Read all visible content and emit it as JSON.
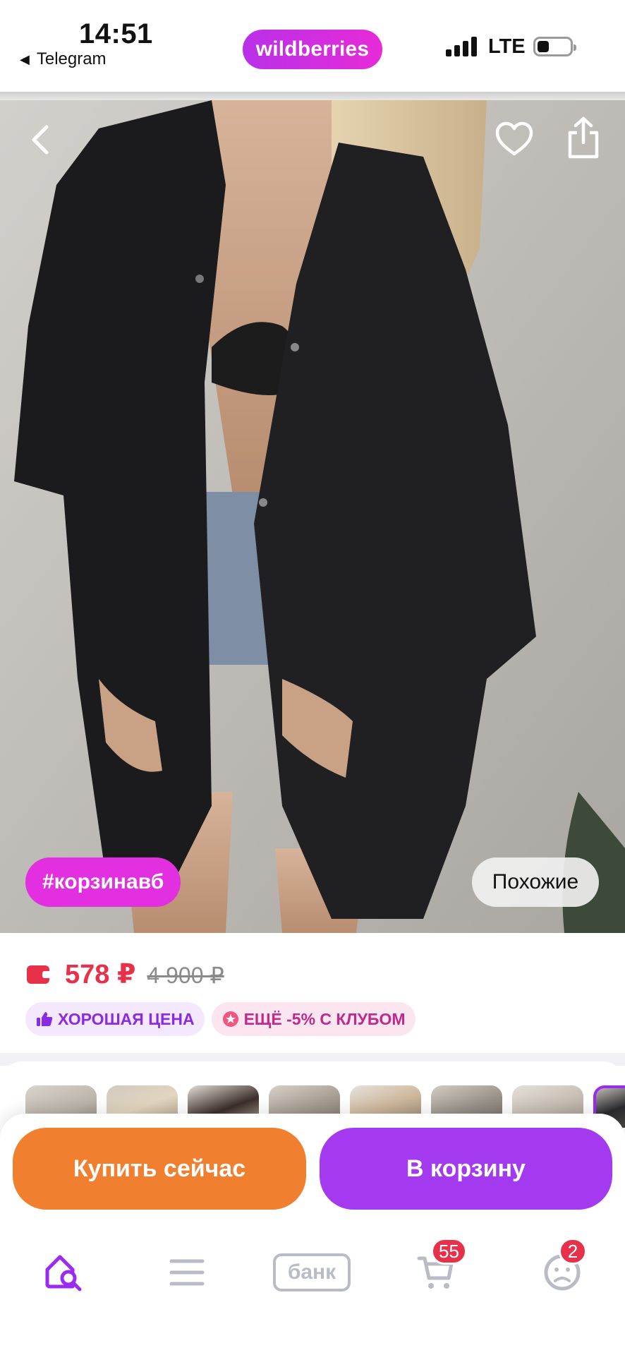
{
  "status_bar": {
    "time": "14:51",
    "back_app": "Telegram",
    "network": "LTE",
    "brand": "wildberries"
  },
  "photo": {
    "tag": "#корзинавб",
    "similar_label": "Похожие",
    "icons": [
      "chevron-left-icon",
      "heart-icon",
      "share-icon"
    ]
  },
  "price": {
    "current": "578 ₽",
    "old": "4 900 ₽",
    "badges": [
      {
        "icon": "thumbs-up-icon",
        "label": "ХОРОШАЯ ЦЕНА"
      },
      {
        "icon": "club-star-icon",
        "label": "ЕЩЁ -5% С КЛУБОМ"
      }
    ]
  },
  "thumbnails": {
    "count": 8,
    "active_index": 7
  },
  "actions": {
    "buy_now": "Купить сейчас",
    "add_to_cart": "В корзину"
  },
  "tabbar": {
    "bank_label": "банк",
    "cart_count": "55",
    "profile_count": "2"
  },
  "colors": {
    "brand": "#cb2ee4",
    "price": "#e7304a",
    "buy": "#f08030",
    "cart": "#a43af0"
  }
}
